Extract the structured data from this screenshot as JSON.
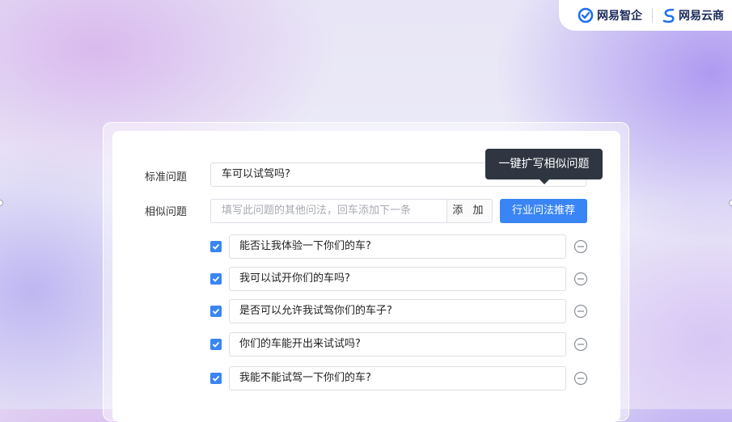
{
  "brand": {
    "left_name": "网易智企",
    "right_name": "网易云商",
    "accent": "#1f6ff2"
  },
  "form": {
    "standard_label": "标准问题",
    "standard_value": "车可以试驾吗?",
    "similar_label": "相似问题",
    "similar_placeholder": "填写此问题的其他问法，回车添加下一条",
    "add_label": "添 加",
    "recommend_label": "行业问法推荐",
    "tooltip": "一键扩写相似问题",
    "primary_color": "#3a85f5"
  },
  "items": [
    {
      "text": "能否让我体验一下你们的车?",
      "checked": true
    },
    {
      "text": "我可以试开你们的车吗?",
      "checked": true
    },
    {
      "text": "是否可以允许我试驾你们的车子?",
      "checked": true
    },
    {
      "text": "你们的车能开出来试试吗?",
      "checked": true
    },
    {
      "text": "我能不能试驾一下你们的车?",
      "checked": true
    }
  ],
  "icons": {
    "checkbox": "check-icon",
    "remove": "minus-circle-icon"
  }
}
